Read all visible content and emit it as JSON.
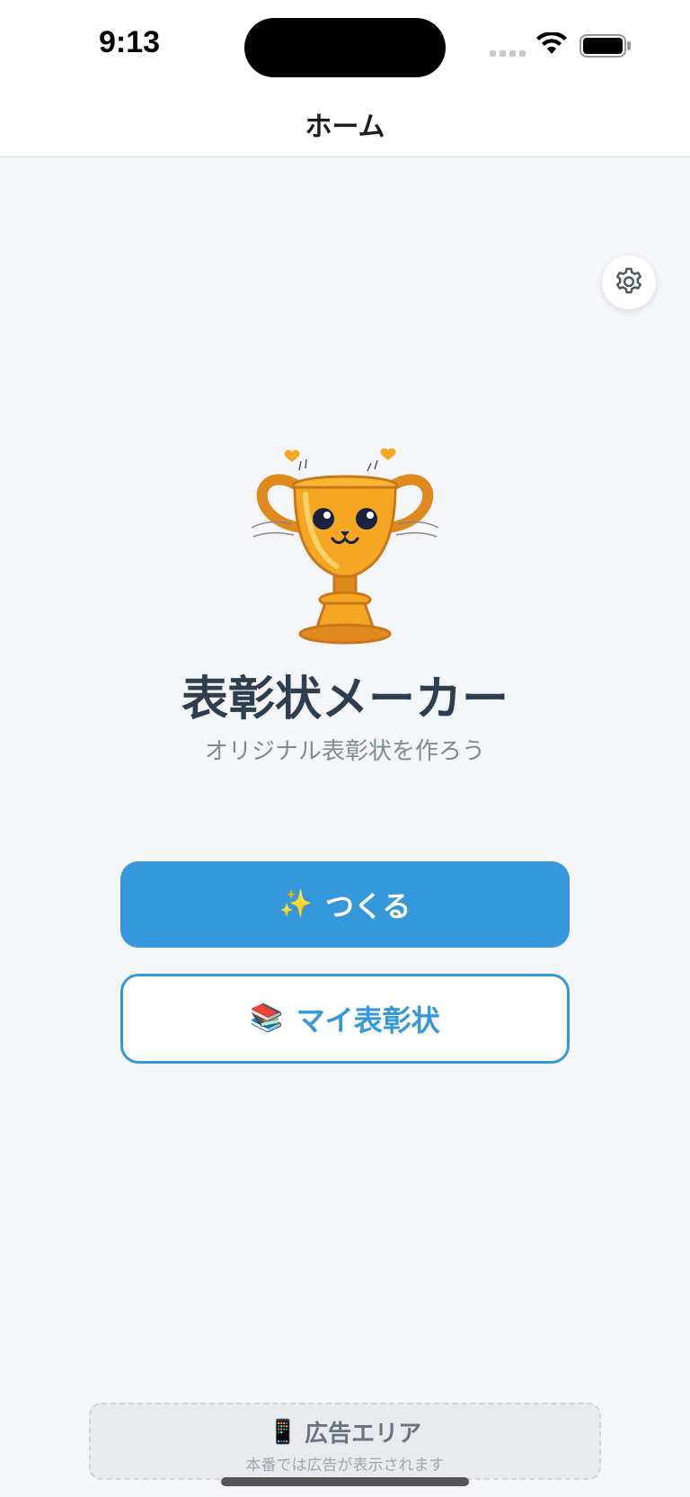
{
  "status_bar": {
    "time": "9:13",
    "icons": [
      "signal-icon",
      "wifi-icon",
      "battery-icon"
    ]
  },
  "nav": {
    "title": "ホーム"
  },
  "settings": {
    "icon": "gear-icon"
  },
  "hero": {
    "illustration": "trophy-mascot",
    "title": "表彰状メーカー",
    "subtitle": "オリジナル表彰状を作ろう"
  },
  "actions": {
    "create": {
      "icon": "✨",
      "label": "つくる"
    },
    "my_awards": {
      "icon": "📚",
      "label": "マイ表彰状"
    }
  },
  "ad": {
    "icon": "📱",
    "title": "広告エリア",
    "subtitle": "本番では広告が表示されます"
  },
  "colors": {
    "accent": "#3498db",
    "title_text": "#2c3e50",
    "subtitle_text": "#7f8c8d",
    "background": "#f4f6f9",
    "trophy_gold": "#f5a623"
  }
}
